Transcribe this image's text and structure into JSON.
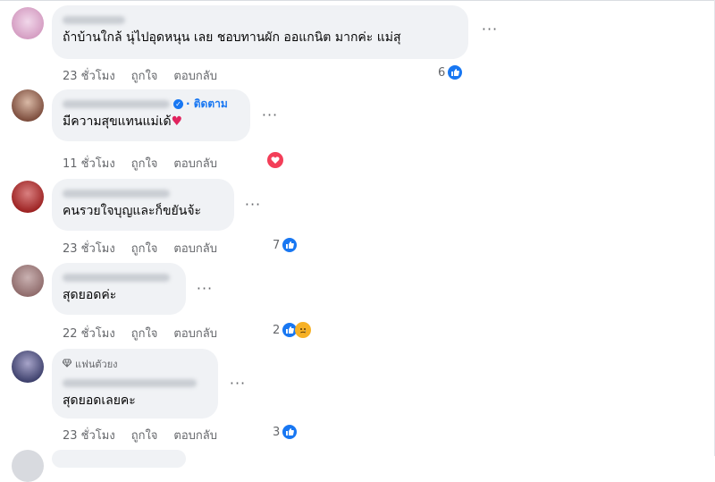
{
  "colors": {
    "accent": "#1877f2",
    "bubble": "#f0f2f5",
    "meta_text": "#65676b",
    "love": "#f33e58",
    "sad": "#f7b125"
  },
  "comments": [
    {
      "text": "ถ้าบ้านใกล้ นุ่ไปอุดหนุน เลย ชอบทานผัก ออแกนิต มากค่ะ แม่สุ",
      "time": "23 ชั่วโมง",
      "like_label": "ถูกใจ",
      "reply_label": "ตอบกลับ",
      "reaction_count": "6",
      "reactions": [
        "like-icon"
      ]
    },
    {
      "follow_label": "· ติดตาม",
      "text": "มีความสุขแทนแม่เด้",
      "time": "11 ชั่วโมง",
      "like_label": "ถูกใจ",
      "reply_label": "ตอบกลับ",
      "reaction_count": "",
      "reactions": [
        "love-icon"
      ]
    },
    {
      "text": "คนรวยใจบุญและก็ขยันจ้ะ",
      "time": "23 ชั่วโมง",
      "like_label": "ถูกใจ",
      "reply_label": "ตอบกลับ",
      "reaction_count": "7",
      "reactions": [
        "like-icon"
      ]
    },
    {
      "text": "สุดยอดค่ะ",
      "time": "22 ชั่วโมง",
      "like_label": "ถูกใจ",
      "reply_label": "ตอบกลับ",
      "reaction_count": "2",
      "reactions": [
        "like-icon",
        "sad-icon"
      ]
    },
    {
      "badge_label": "แฟนตัวยง",
      "text": "สุดยอดเลยคะ",
      "time": "23 ชั่วโมง",
      "like_label": "ถูกใจ",
      "reply_label": "ตอบกลับ",
      "reaction_count": "3",
      "reactions": [
        "like-icon"
      ]
    }
  ],
  "more_label": "···"
}
